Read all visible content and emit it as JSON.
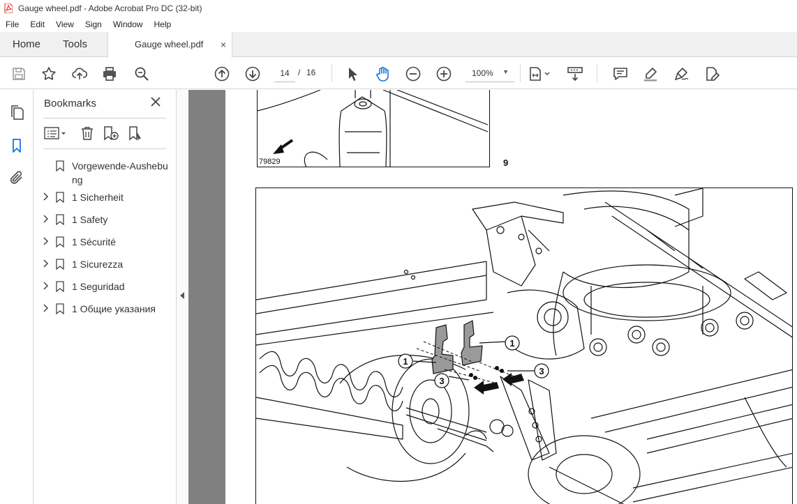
{
  "window": {
    "title": "Gauge wheel.pdf - Adobe Acrobat Pro DC (32-bit)"
  },
  "menu": [
    "File",
    "Edit",
    "View",
    "Sign",
    "Window",
    "Help"
  ],
  "tabs": {
    "home": "Home",
    "tools": "Tools",
    "document": "Gauge wheel.pdf",
    "close_glyph": "×"
  },
  "toolbar": {
    "page_current": "14",
    "page_separator": "/",
    "page_total": "16",
    "zoom": "100%",
    "icons": [
      "save-icon",
      "star-icon",
      "upload-icon",
      "print-icon",
      "search-zoom-icon",
      "arrow-up-icon",
      "arrow-down-icon",
      "select-arrow-icon",
      "hand-icon",
      "zoom-out-icon",
      "zoom-in-icon",
      "page-fit-icon",
      "scroll-mode-icon",
      "comment-icon",
      "highlight-pen-icon",
      "sign-icon",
      "edit-pdf-icon"
    ]
  },
  "rail": {
    "icons": [
      "pages-icon",
      "bookmark-icon",
      "attachment-icon"
    ]
  },
  "bookmarks": {
    "title": "Bookmarks",
    "items": [
      {
        "label": "Vorgewende-Aushebung",
        "expandable": false
      },
      {
        "label": "1 Sicherheit",
        "expandable": true
      },
      {
        "label": "1 Safety",
        "expandable": true
      },
      {
        "label": "1 Sécurité",
        "expandable": true
      },
      {
        "label": "1 Sicurezza",
        "expandable": true
      },
      {
        "label": "1 Seguridad",
        "expandable": true
      },
      {
        "label": "1 Общие указания",
        "expandable": true
      }
    ]
  },
  "document": {
    "figure_top_number": "79829",
    "step_number": "9",
    "callouts": [
      "1",
      "1",
      "3",
      "3"
    ]
  },
  "colors": {
    "accent": "#1473e6",
    "doc_background": "#808080",
    "tab_bar": "#f0f0f0"
  }
}
